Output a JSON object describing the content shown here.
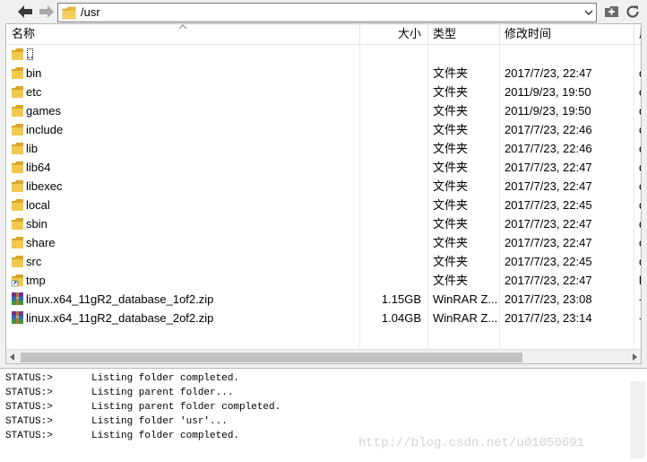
{
  "toolbar": {
    "back_icon": "back-arrow-icon",
    "forward_icon": "forward-arrow-icon",
    "path": "/usr",
    "folder_icon": "folder-icon",
    "dropdown_icon": "chevron-down-icon",
    "new_folder_icon": "new-folder-icon",
    "refresh_icon": "refresh-icon"
  },
  "columns": {
    "name": "名称",
    "size": "大小",
    "type": "类型",
    "modified": "修改时间",
    "extra": "属"
  },
  "files": [
    {
      "name": "..",
      "size": "",
      "type": "",
      "modified": "",
      "extra": "",
      "icon": "folder"
    },
    {
      "name": "bin",
      "size": "",
      "type": "文件夹",
      "modified": "2017/7/23, 22:47",
      "extra": "d",
      "icon": "folder"
    },
    {
      "name": "etc",
      "size": "",
      "type": "文件夹",
      "modified": "2011/9/23, 19:50",
      "extra": "d",
      "icon": "folder"
    },
    {
      "name": "games",
      "size": "",
      "type": "文件夹",
      "modified": "2011/9/23, 19:50",
      "extra": "d",
      "icon": "folder"
    },
    {
      "name": "include",
      "size": "",
      "type": "文件夹",
      "modified": "2017/7/23, 22:46",
      "extra": "d",
      "icon": "folder"
    },
    {
      "name": "lib",
      "size": "",
      "type": "文件夹",
      "modified": "2017/7/23, 22:46",
      "extra": "d",
      "icon": "folder"
    },
    {
      "name": "lib64",
      "size": "",
      "type": "文件夹",
      "modified": "2017/7/23, 22:47",
      "extra": "d",
      "icon": "folder"
    },
    {
      "name": "libexec",
      "size": "",
      "type": "文件夹",
      "modified": "2017/7/23, 22:47",
      "extra": "d",
      "icon": "folder"
    },
    {
      "name": "local",
      "size": "",
      "type": "文件夹",
      "modified": "2017/7/23, 22:45",
      "extra": "d",
      "icon": "folder"
    },
    {
      "name": "sbin",
      "size": "",
      "type": "文件夹",
      "modified": "2017/7/23, 22:47",
      "extra": "d",
      "icon": "folder"
    },
    {
      "name": "share",
      "size": "",
      "type": "文件夹",
      "modified": "2017/7/23, 22:47",
      "extra": "d",
      "icon": "folder"
    },
    {
      "name": "src",
      "size": "",
      "type": "文件夹",
      "modified": "2017/7/23, 22:45",
      "extra": "d",
      "icon": "folder"
    },
    {
      "name": "tmp",
      "size": "",
      "type": "文件夹",
      "modified": "2017/7/23, 22:47",
      "extra": "l",
      "icon": "folder-link"
    },
    {
      "name": "linux.x64_11gR2_database_1of2.zip",
      "size": "1.15GB",
      "type": "WinRAR Z...",
      "modified": "2017/7/23, 23:08",
      "extra": "-",
      "icon": "winrar-archive"
    },
    {
      "name": "linux.x64_11gR2_database_2of2.zip",
      "size": "1.04GB",
      "type": "WinRAR Z...",
      "modified": "2017/7/23, 23:14",
      "extra": "-",
      "icon": "winrar-archive"
    }
  ],
  "log": [
    {
      "status": "STATUS:>",
      "message": "Listing folder completed."
    },
    {
      "status": "STATUS:>",
      "message": "Listing parent folder..."
    },
    {
      "status": "STATUS:>",
      "message": "Listing parent folder completed."
    },
    {
      "status": "STATUS:>",
      "message": "Listing folder 'usr'..."
    },
    {
      "status": "STATUS:>",
      "message": "Listing folder completed."
    }
  ],
  "watermark": "http://blog.csdn.net/u01050691",
  "colors": {
    "folder": "#e8b93a",
    "selection_border": "#000000",
    "watermark": "#d3d3d3"
  }
}
